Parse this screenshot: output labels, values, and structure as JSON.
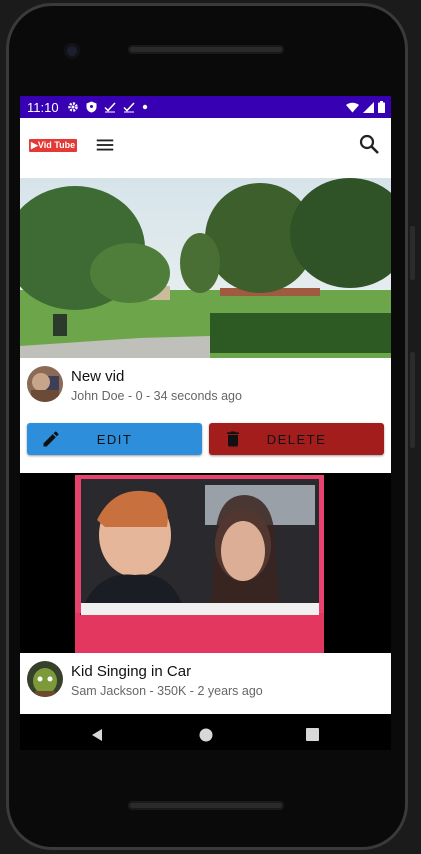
{
  "status_bar": {
    "time": "11:10"
  },
  "app_bar": {
    "logo_text": "▶Vid Tube"
  },
  "videos": [
    {
      "title": "New vid",
      "meta": "John Doe - 0 - 34 seconds ago",
      "edit_label": "EDIT",
      "delete_label": "DELETE"
    },
    {
      "title": "Kid Singing in Car",
      "meta": "Sam Jackson - 350K - 2 years ago"
    }
  ],
  "colors": {
    "status_bar": "#3700b3",
    "edit_button": "#2d8fdc",
    "delete_button": "#a31d1d",
    "logo": "#e53935"
  },
  "icons": [
    "gear-icon",
    "shield-icon",
    "check-icon",
    "dot-icon",
    "wifi-icon",
    "signal-icon",
    "battery-icon",
    "menu-icon",
    "search-icon",
    "pencil-icon",
    "trash-icon",
    "back-icon",
    "home-icon",
    "recents-icon"
  ]
}
